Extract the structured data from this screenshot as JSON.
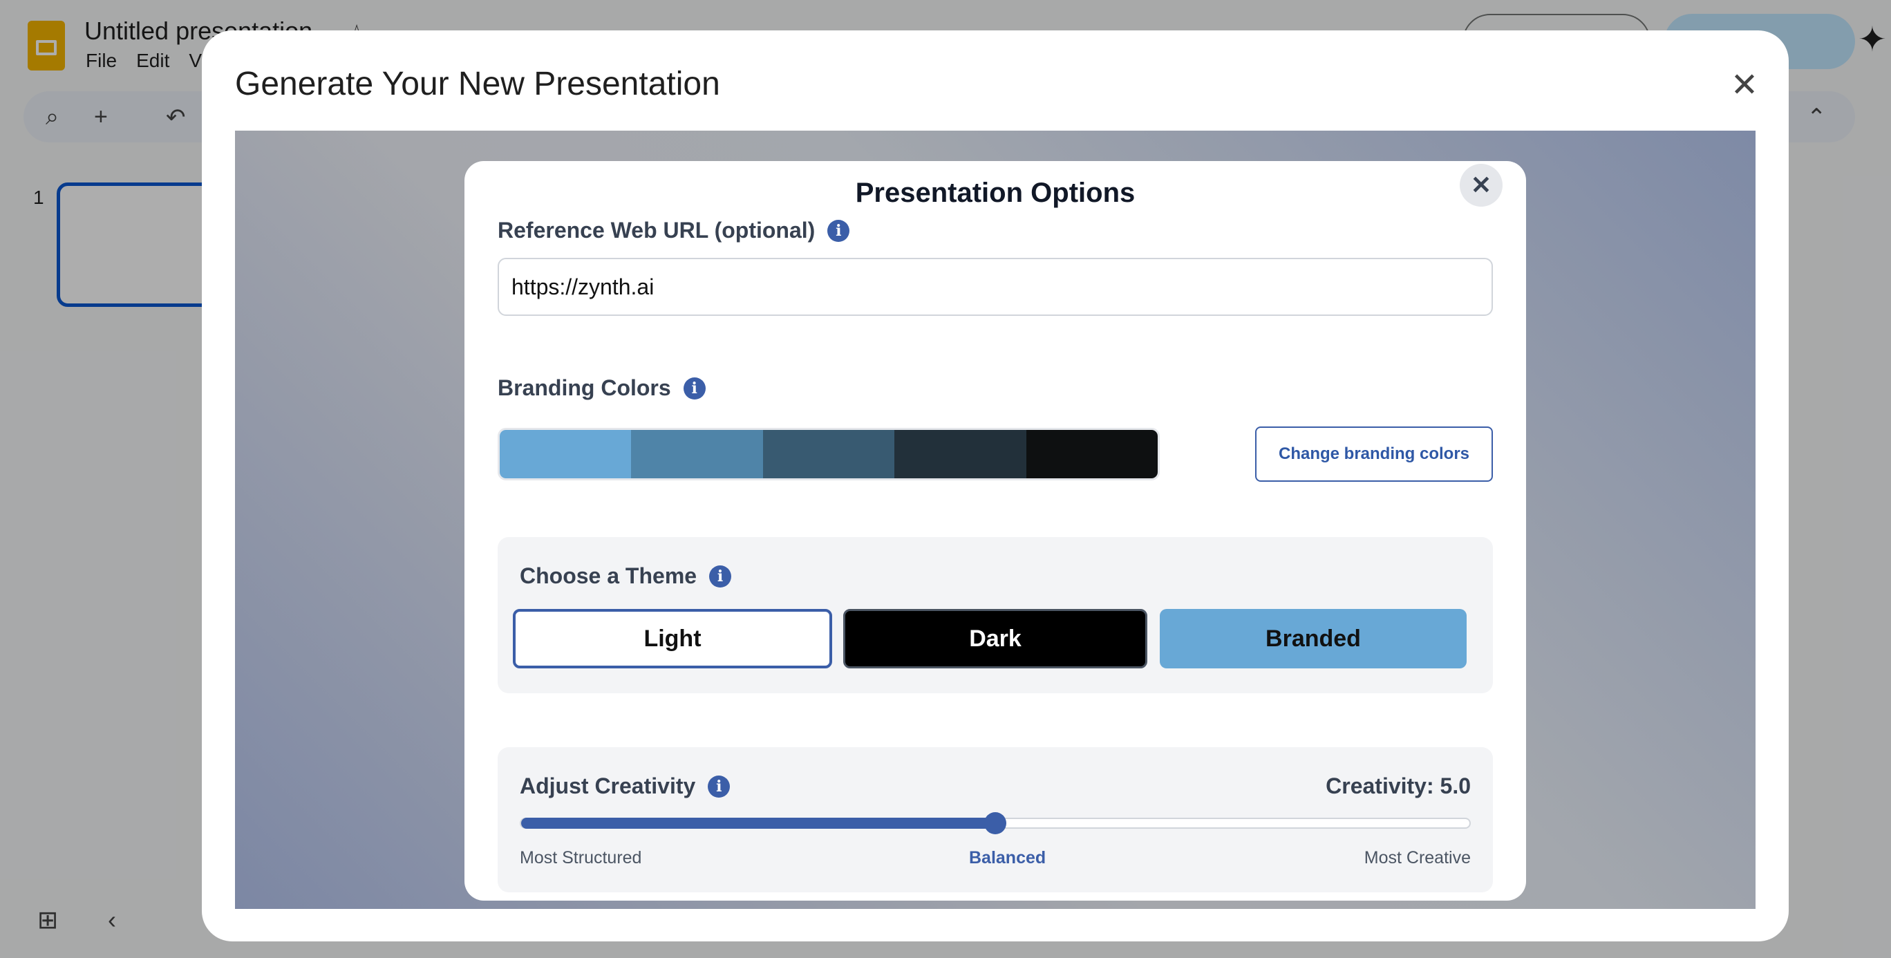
{
  "app": {
    "doc_title": "Untitled presentation",
    "menu": [
      "File",
      "Edit",
      "View"
    ],
    "slide_number": "1"
  },
  "dialog": {
    "title": "Generate Your New Presentation",
    "close_symbol": "✕"
  },
  "options": {
    "title": "Presentation Options",
    "close_symbol": "✕",
    "reference_url": {
      "label": "Reference Web URL (optional)",
      "value": "https://zynth.ai"
    },
    "branding": {
      "label": "Branding Colors",
      "colors": [
        "#68a8d6",
        "#4f84a8",
        "#385a71",
        "#22303a",
        "#0e1011"
      ],
      "change_button": "Change branding colors"
    },
    "theme": {
      "label": "Choose a Theme",
      "options": [
        "Light",
        "Dark",
        "Branded"
      ],
      "selected": "Light"
    },
    "creativity": {
      "label": "Adjust Creativity",
      "value_text": "Creativity: 5.0",
      "value": 5.0,
      "min": 0,
      "max": 10,
      "scale_labels": [
        "Most Structured",
        "Balanced",
        "Most Creative"
      ]
    }
  },
  "colors": {
    "accent": "#3b5ea8",
    "panel_bg": "#f3f4f6"
  }
}
